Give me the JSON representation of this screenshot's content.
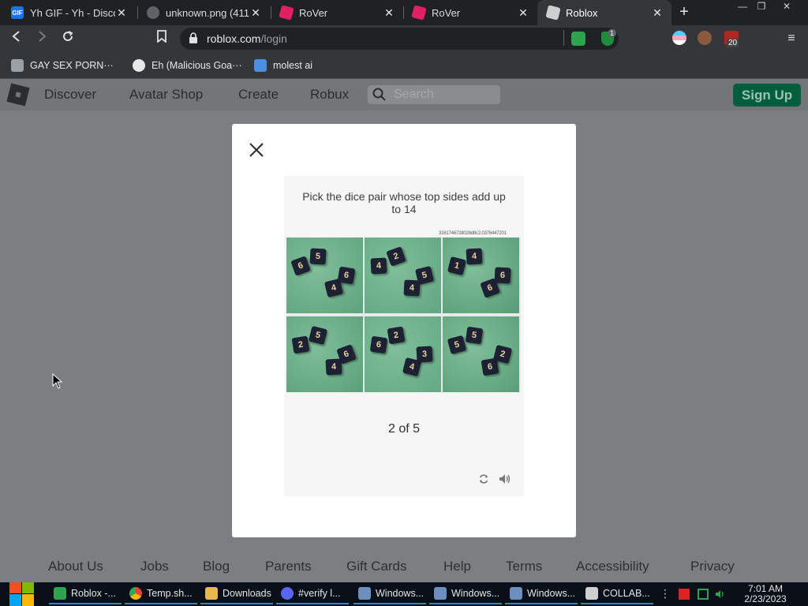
{
  "browser": {
    "tabs": [
      {
        "title": "Yh GIF - Yh - Disco",
        "icon": "gif-icon"
      },
      {
        "title": "unknown.png (411×",
        "icon": "globe-icon"
      },
      {
        "title": "RoVer",
        "icon": "rover-icon"
      },
      {
        "title": "RoVer",
        "icon": "rover-icon"
      },
      {
        "title": "Roblox",
        "icon": "roblox-icon",
        "active": true
      }
    ],
    "tab_gif_badge": "GIF",
    "url_host": "roblox.com",
    "url_path": "/login",
    "extension_badge": "1",
    "extension_count": "20",
    "bookmarks": [
      {
        "label": "GAY SEX PORN···"
      },
      {
        "label": "Eh (Malicious Goa···"
      },
      {
        "label": "molest ai"
      }
    ]
  },
  "roblox_header": {
    "nav": [
      "Discover",
      "Avatar Shop",
      "Create",
      "Robux"
    ],
    "search_placeholder": "Search",
    "signup_label": "Sign Up",
    "accent": "#00a35c"
  },
  "captcha": {
    "instruction": "Pick the dice pair whose top sides add up to 14",
    "challenge_id": "3161746728026d8c2.0376447201",
    "progress": "2 of 5",
    "cells": [
      {
        "dice": [
          "6",
          "5",
          "4",
          "6"
        ]
      },
      {
        "dice": [
          "4",
          "2",
          "4",
          "5"
        ]
      },
      {
        "dice": [
          "1",
          "4",
          "6",
          "6"
        ]
      },
      {
        "dice": [
          "2",
          "5",
          "4",
          "6"
        ]
      },
      {
        "dice": [
          "6",
          "2",
          "4",
          "3"
        ]
      },
      {
        "dice": [
          "5",
          "5",
          "6",
          "2"
        ]
      }
    ]
  },
  "footer": {
    "links": [
      "About Us",
      "Jobs",
      "Blog",
      "Parents",
      "Gift Cards",
      "Help",
      "Terms",
      "Accessibility",
      "Privacy"
    ]
  },
  "taskbar": {
    "items": [
      "Roblox -...",
      "Temp.sh...",
      "Downloads",
      "#verify l...",
      "Windows...",
      "Windows...",
      "Windows...",
      "COLLAB..."
    ],
    "time": "7:01 AM",
    "date": "2/23/2023"
  }
}
